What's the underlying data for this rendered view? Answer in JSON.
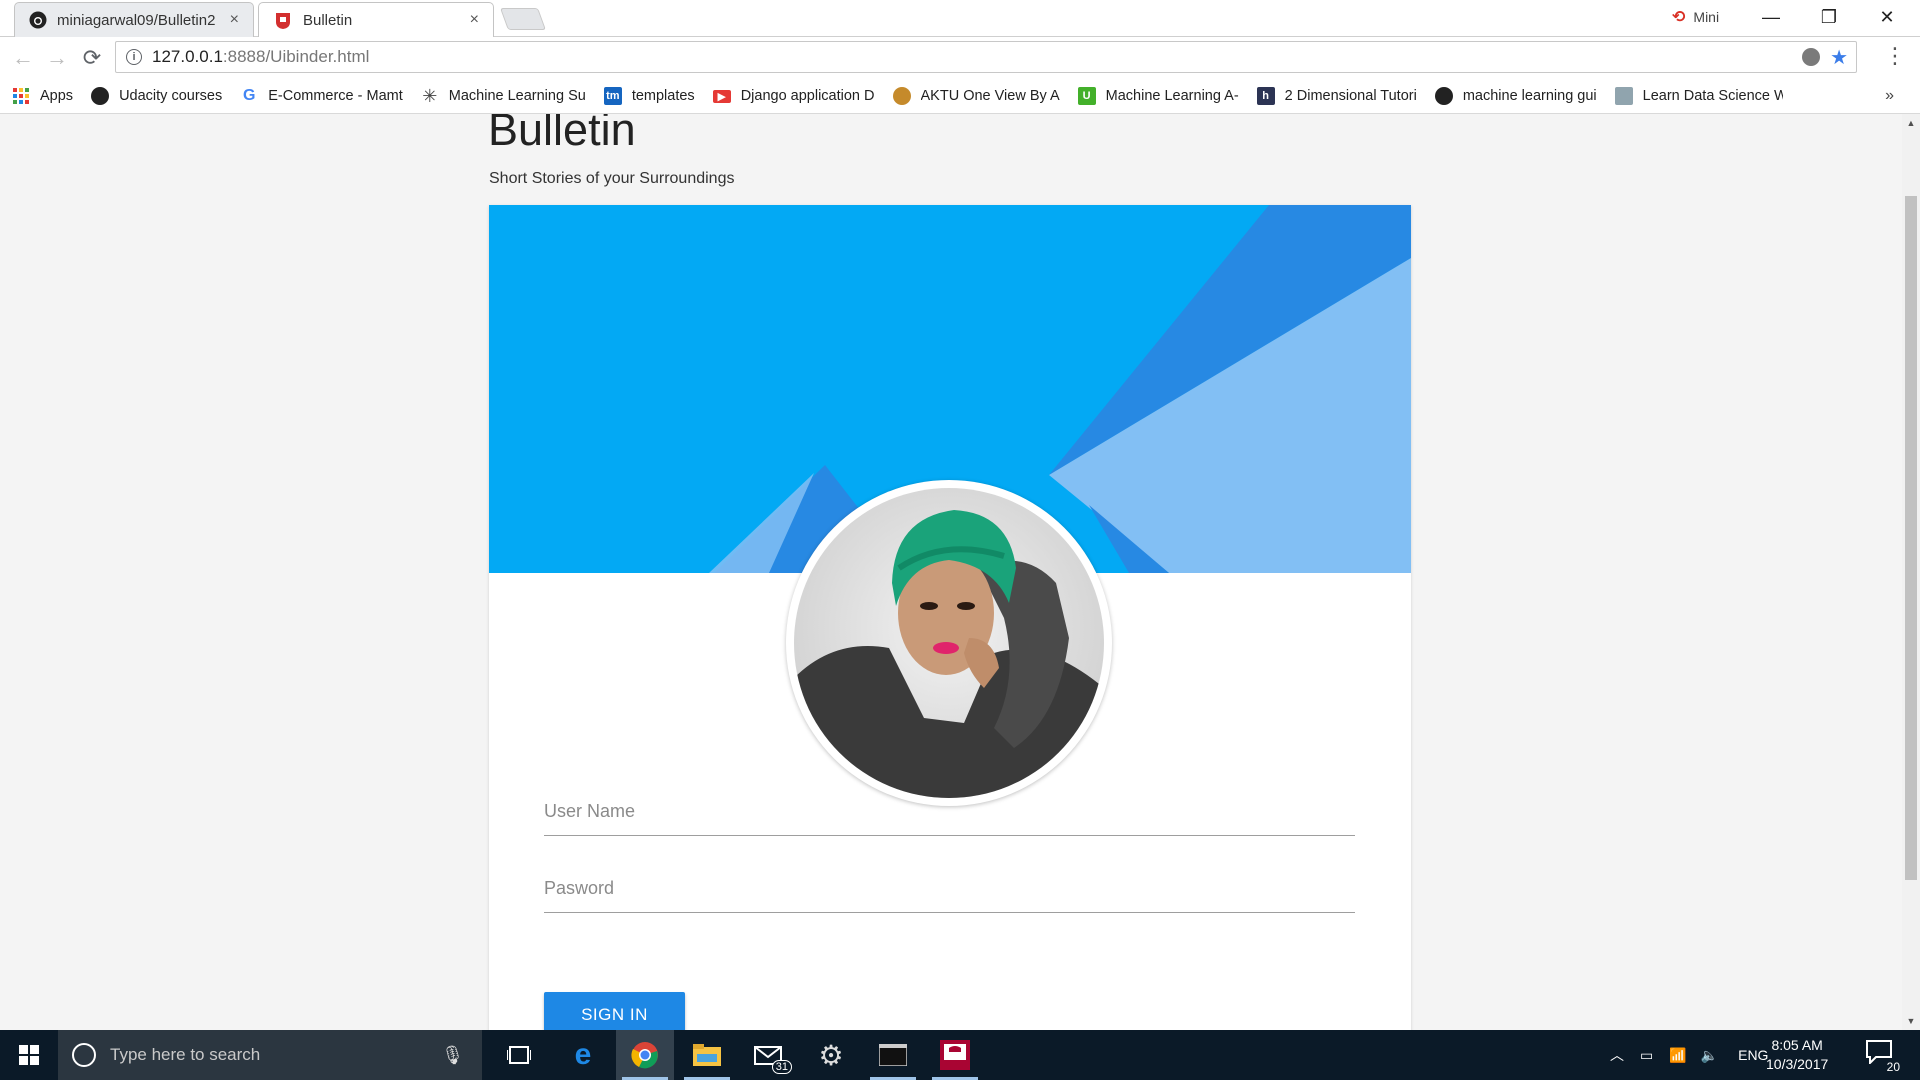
{
  "browser": {
    "tabs": [
      {
        "title": "miniagarwal09/Bulletin2",
        "close": "×",
        "active": false
      },
      {
        "title": "Bulletin",
        "close": "×",
        "active": true
      }
    ],
    "profile_name": "Mini",
    "window_controls": {
      "minimize": "—",
      "restore": "❐",
      "close": "✕"
    },
    "nav": {
      "back": "←",
      "forward": "→",
      "reload": "⟳"
    },
    "url_host": "127.0.0.1",
    "url_path": ":8888/Uibinder.html",
    "info_icon": "i",
    "star": "★",
    "menu": "⋮",
    "bookmarks": [
      {
        "label": "Apps",
        "icon": "apps-grid-icon"
      },
      {
        "label": "Udacity courses",
        "icon": "github-icon"
      },
      {
        "label": "E-Commerce - Mamt",
        "icon": "google-icon"
      },
      {
        "label": "Machine Learning Su",
        "icon": "atom-icon"
      },
      {
        "label": "templates",
        "icon": "tm-icon"
      },
      {
        "label": "Django application D",
        "icon": "youtube-icon"
      },
      {
        "label": "AKTU One View By A",
        "icon": "aktu-icon"
      },
      {
        "label": "Machine Learning A-",
        "icon": "udemy-icon"
      },
      {
        "label": "2 Dimensional Tutori",
        "icon": "hackerearth-icon"
      },
      {
        "label": "machine learning gui",
        "icon": "github-icon"
      },
      {
        "label": "Learn Data Science W",
        "icon": "datascience-icon"
      }
    ],
    "bookmarks_overflow": "»"
  },
  "page": {
    "title": "Bulletin",
    "subtitle": "Short Stories of your Surroundings",
    "username_placeholder": "User Name",
    "password_placeholder": "Pasword",
    "signin_label": "SIGN IN",
    "colors": {
      "banner_main": "#03a9f4",
      "banner_dark": "#2789e3",
      "banner_light": "#82bff4",
      "button": "#1e88e5"
    }
  },
  "taskbar": {
    "search_placeholder": "Type here to search",
    "mail_badge": "31",
    "tray_lang": "ENG",
    "time": "8:05 AM",
    "date": "10/3/2017",
    "notifications": "20"
  }
}
